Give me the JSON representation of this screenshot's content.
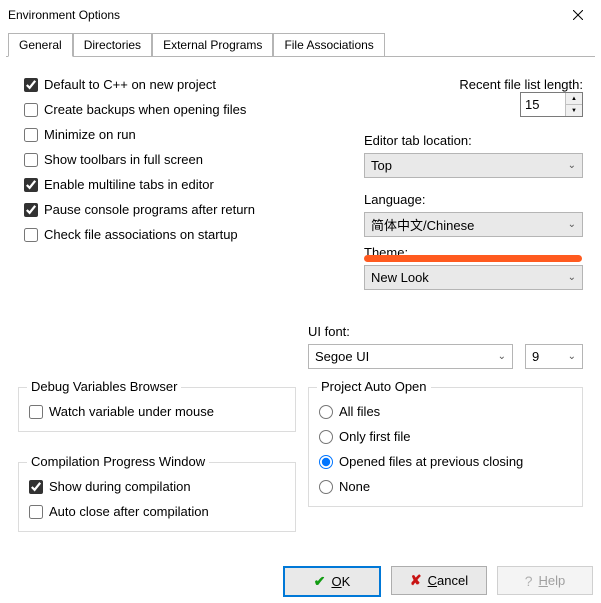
{
  "window": {
    "title": "Environment Options"
  },
  "tabs": {
    "items": [
      {
        "label": "General"
      },
      {
        "label": "Directories"
      },
      {
        "label": "External Programs"
      },
      {
        "label": "File Associations"
      }
    ],
    "active_index": 0
  },
  "options": {
    "default_cpp": {
      "label": "Default to C++ on new project",
      "checked": true
    },
    "create_backups": {
      "label": "Create backups when opening files",
      "checked": false
    },
    "minimize_on_run": {
      "label": "Minimize on run",
      "checked": false
    },
    "toolbars_fullscreen": {
      "label": "Show toolbars in full screen",
      "checked": false
    },
    "multiline_tabs": {
      "label": "Enable multiline tabs in editor",
      "checked": true
    },
    "pause_console": {
      "label": "Pause console programs after return",
      "checked": true
    },
    "check_assoc": {
      "label": "Check file associations on startup",
      "checked": false
    }
  },
  "recent": {
    "label": "Recent file list length:",
    "value": "15"
  },
  "editor_tab": {
    "label": "Editor tab location:",
    "value": "Top"
  },
  "language": {
    "label": "Language:",
    "value": "简体中文/Chinese"
  },
  "theme": {
    "label": "Theme:",
    "value": "New Look"
  },
  "ui_font": {
    "label": "UI font:",
    "name": "Segoe UI",
    "size": "9"
  },
  "debug_group": {
    "title": "Debug Variables Browser",
    "watch": {
      "label": "Watch variable under mouse",
      "checked": false
    }
  },
  "compile_group": {
    "title": "Compilation Progress Window",
    "show": {
      "label": "Show during compilation",
      "checked": true
    },
    "auto_close": {
      "label": "Auto close after compilation",
      "checked": false
    }
  },
  "project_auto_open": {
    "title": "Project Auto Open",
    "options": {
      "all": {
        "label": "All files"
      },
      "first": {
        "label": "Only first file"
      },
      "opened": {
        "label": "Opened files at previous closing"
      },
      "none": {
        "label": "None"
      }
    },
    "selected": "opened"
  },
  "buttons": {
    "ok": "OK",
    "cancel": "Cancel",
    "help": "Help"
  }
}
